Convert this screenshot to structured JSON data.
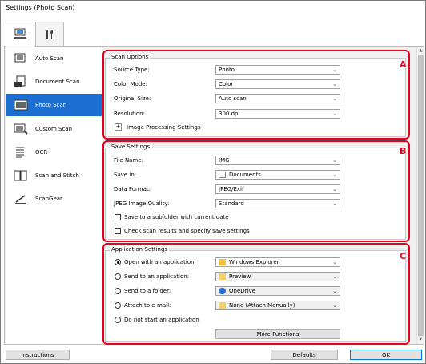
{
  "window": {
    "title": "Settings (Photo Scan)"
  },
  "tabs": [
    {
      "name": "scan-settings"
    },
    {
      "name": "general-settings"
    }
  ],
  "sidebar": {
    "items": [
      {
        "label": "Auto Scan"
      },
      {
        "label": "Document Scan"
      },
      {
        "label": "Photo Scan",
        "selected": true
      },
      {
        "label": "Custom Scan"
      },
      {
        "label": "OCR"
      },
      {
        "label": "Scan and Stitch"
      },
      {
        "label": "ScanGear"
      }
    ]
  },
  "scan_options": {
    "title": "Scan Options",
    "badge": "A",
    "source_type": {
      "label": "Source Type:",
      "value": "Photo"
    },
    "color_mode": {
      "label": "Color Mode:",
      "value": "Color"
    },
    "original_size": {
      "label": "Original Size:",
      "value": "Auto scan"
    },
    "resolution": {
      "label": "Resolution:",
      "value": "300 dpi"
    },
    "image_processing": "Image Processing Settings"
  },
  "save_settings": {
    "title": "Save Settings",
    "badge": "B",
    "file_name": {
      "label": "File Name:",
      "value": "IMG"
    },
    "save_in": {
      "label": "Save in:",
      "value": "Documents"
    },
    "data_format": {
      "label": "Data Format:",
      "value": "JPEG/Exif"
    },
    "jpeg_quality": {
      "label": "JPEG Image Quality:",
      "value": "Standard"
    },
    "subfolder": "Save to a subfolder with current date",
    "check_results": "Check scan results and specify save settings"
  },
  "application_settings": {
    "title": "Application Settings",
    "badge": "C",
    "open_app": {
      "label": "Open with an application:",
      "value": "Windows Explorer",
      "selected": true
    },
    "send_app": {
      "label": "Send to an application:",
      "value": "Preview"
    },
    "send_folder": {
      "label": "Send to a folder:",
      "value": "OneDrive"
    },
    "attach_email": {
      "label": "Attach to e-mail:",
      "value": "None (Attach Manually)"
    },
    "do_not_start": {
      "label": "Do not start an application"
    },
    "more_functions": "More Functions"
  },
  "footer": {
    "instructions": "Instructions",
    "defaults": "Defaults",
    "ok": "OK"
  },
  "colors": {
    "accent": "#1c6fd1",
    "highlight": "#e8001c"
  }
}
